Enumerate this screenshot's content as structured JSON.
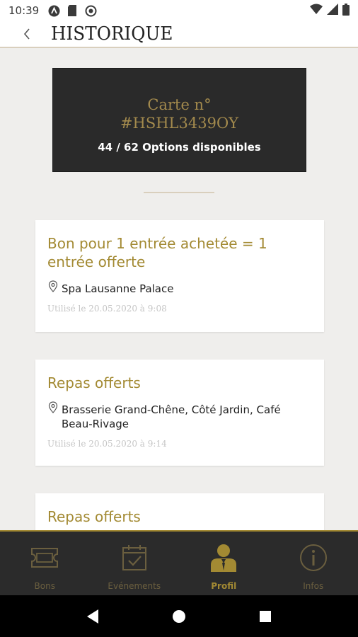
{
  "status": {
    "time": "10:39"
  },
  "header": {
    "title": "HISTORIQUE"
  },
  "card": {
    "line1": "Carte n°",
    "line2": "#HSHL3439OY",
    "options": "44 / 62 Options disponibles"
  },
  "items": [
    {
      "title": "Bon pour 1 entrée achetée = 1 entrée offerte",
      "place": "Spa Lausanne Palace",
      "used": "Utilisé le 20.05.2020 à 9:08"
    },
    {
      "title": "Repas offerts",
      "place": "Brasserie Grand-Chêne, Côté Jardin, Café Beau-Rivage",
      "used": "Utilisé le 20.05.2020 à 9:14"
    },
    {
      "title": "Repas offerts"
    }
  ],
  "nav": [
    {
      "label": "Bons",
      "icon": "ticket-icon"
    },
    {
      "label": "Evénements",
      "icon": "calendar-check-icon"
    },
    {
      "label": "Profil",
      "icon": "person-icon",
      "active": true
    },
    {
      "label": "Infos",
      "icon": "info-icon"
    }
  ],
  "colors": {
    "gold": "#a38a33",
    "dark": "#2b2b2b",
    "background": "#efeeec"
  }
}
